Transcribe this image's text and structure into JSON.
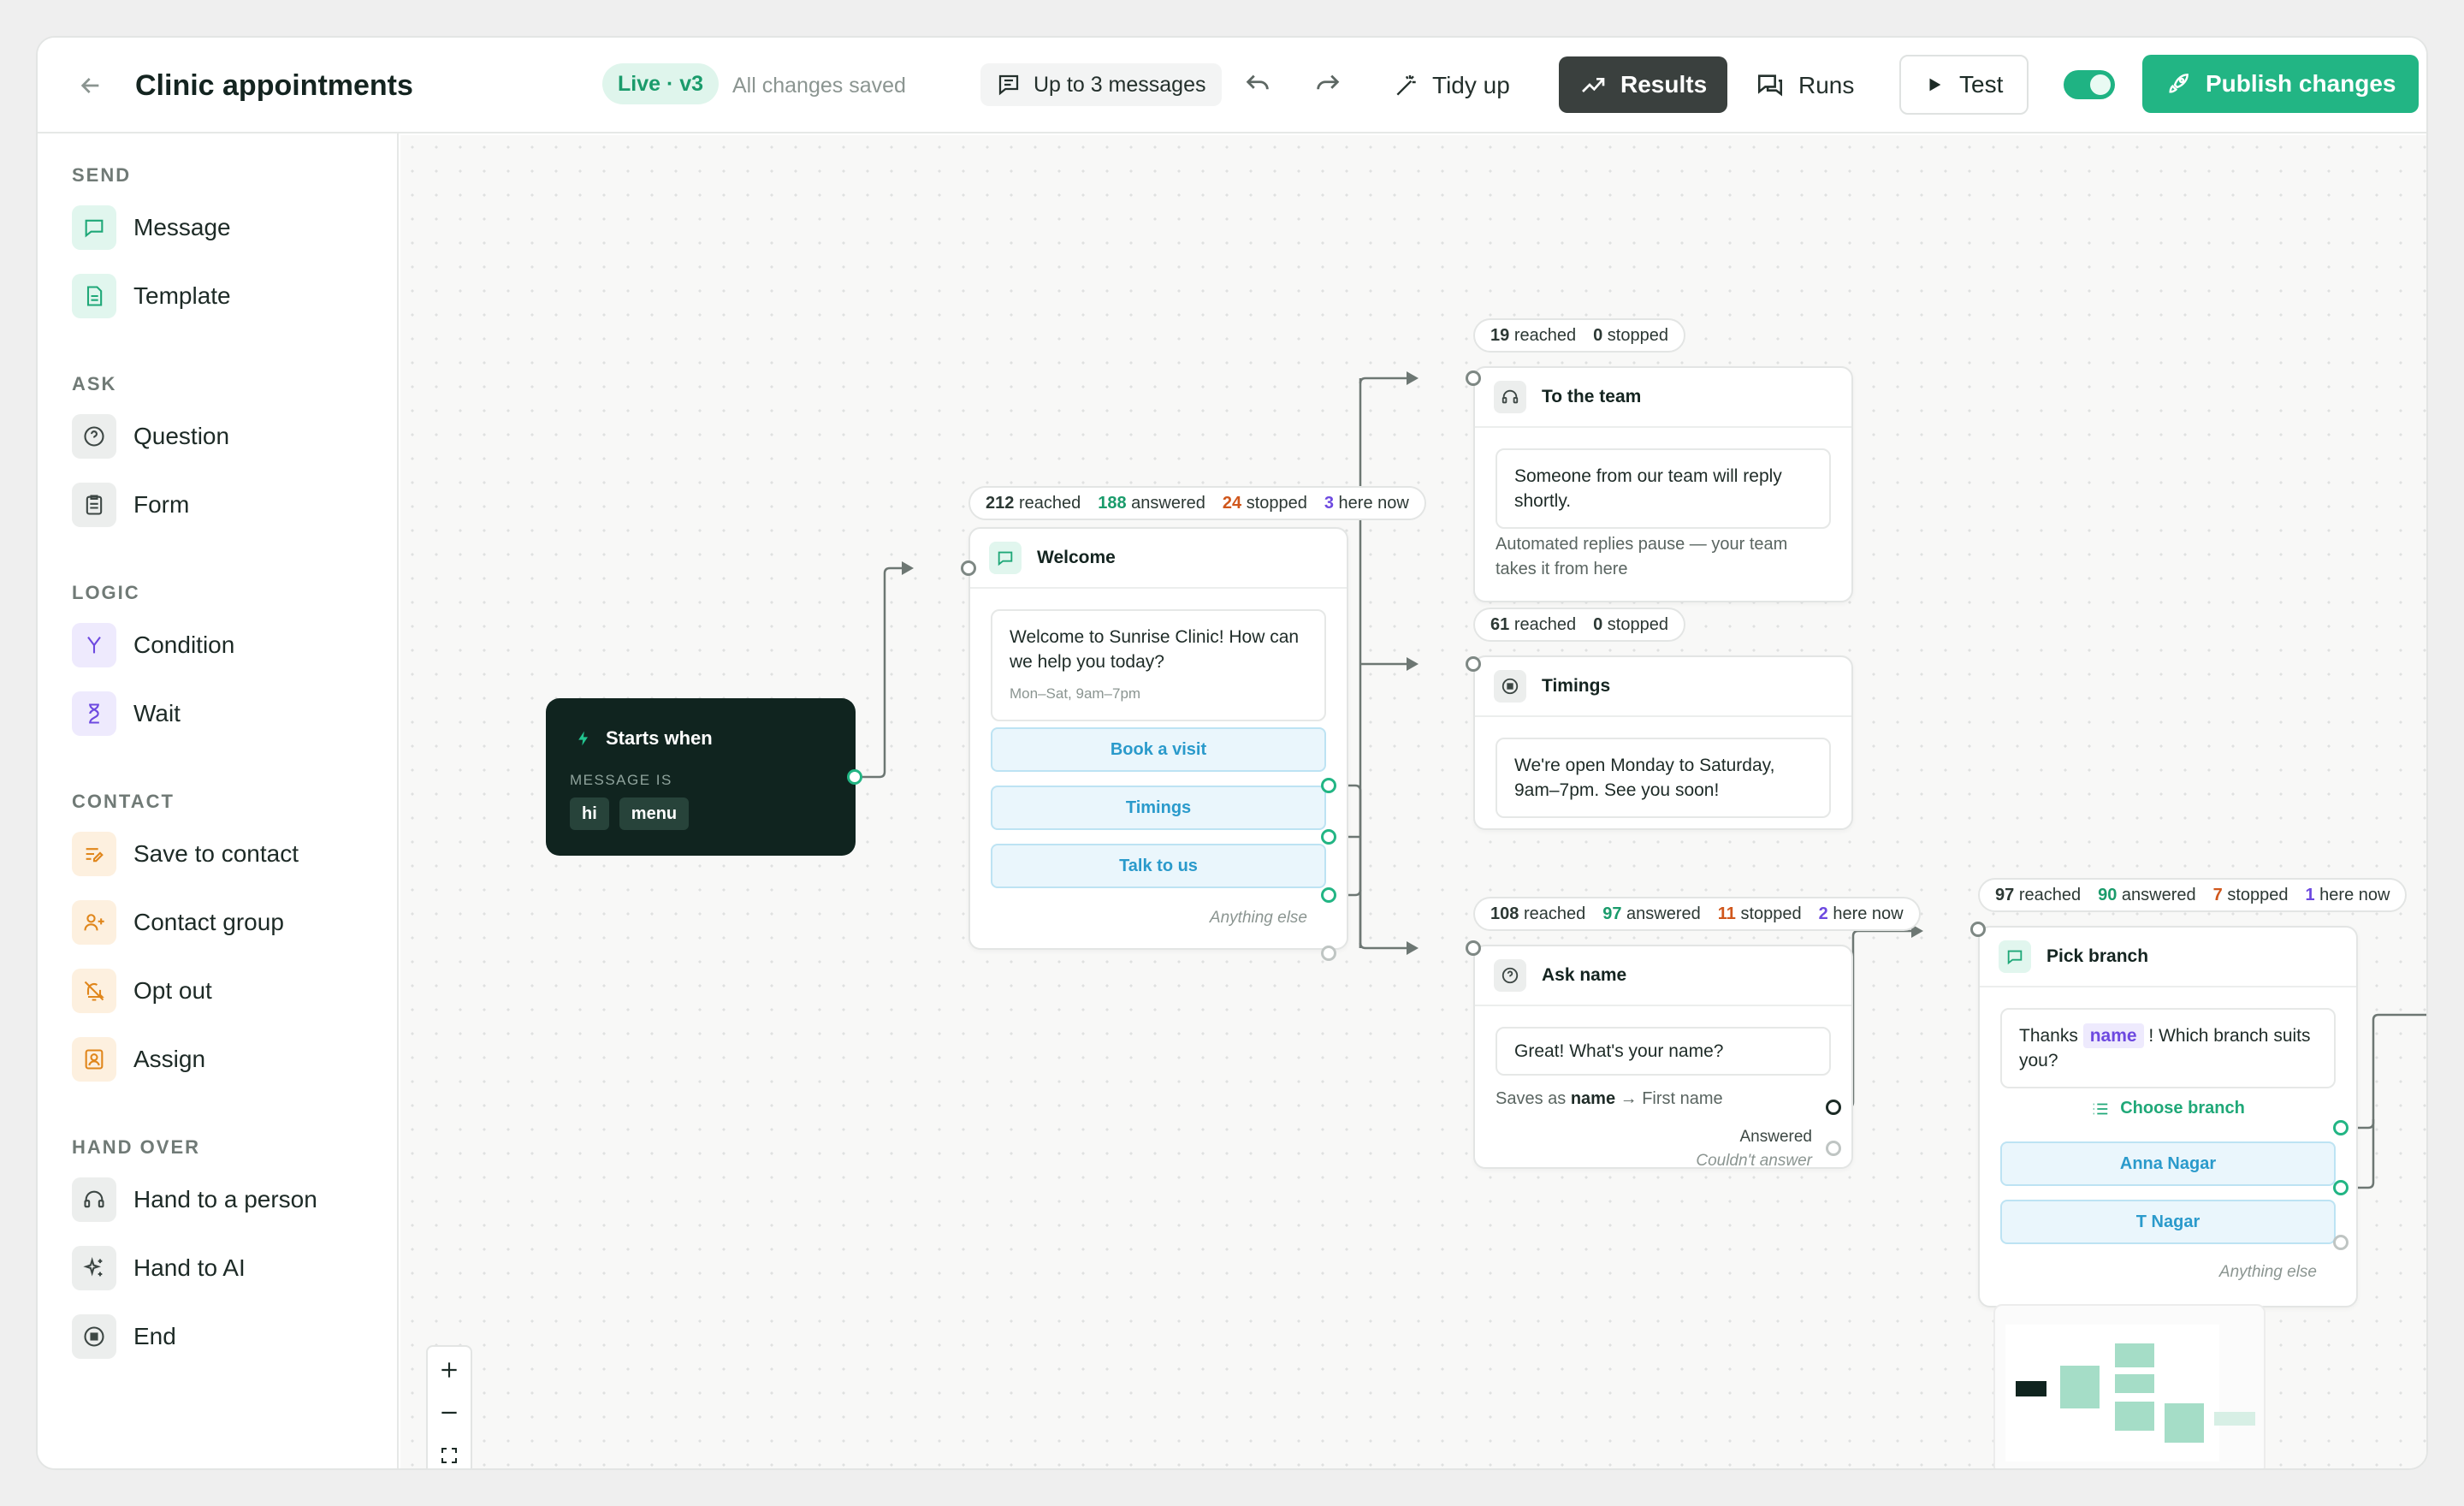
{
  "header": {
    "title": "Clinic appointments",
    "status": "Live · v3",
    "save_state": "All changes saved",
    "message_limit": "Up to 3 messages",
    "tidy_label": "Tidy up",
    "results_label": "Results",
    "runs_label": "Runs",
    "test_label": "Test",
    "publish_label": "Publish changes",
    "live_toggle": "on"
  },
  "sidebar": {
    "sections": [
      {
        "title": "SEND",
        "items": [
          {
            "label": "Message",
            "icon": "message-icon"
          },
          {
            "label": "Template",
            "icon": "template-icon"
          }
        ]
      },
      {
        "title": "ASK",
        "items": [
          {
            "label": "Question",
            "icon": "question-icon"
          },
          {
            "label": "Form",
            "icon": "form-icon"
          }
        ]
      },
      {
        "title": "LOGIC",
        "items": [
          {
            "label": "Condition",
            "icon": "condition-icon"
          },
          {
            "label": "Wait",
            "icon": "hourglass-icon"
          }
        ]
      },
      {
        "title": "CONTACT",
        "items": [
          {
            "label": "Save to contact",
            "icon": "save-contact-icon"
          },
          {
            "label": "Contact group",
            "icon": "contact-group-icon"
          },
          {
            "label": "Opt out",
            "icon": "bell-off-icon"
          },
          {
            "label": "Assign",
            "icon": "assign-icon"
          }
        ]
      },
      {
        "title": "HAND OVER",
        "items": [
          {
            "label": "Hand to a person",
            "icon": "headset-icon"
          },
          {
            "label": "Hand to AI",
            "icon": "sparkle-icon"
          },
          {
            "label": "End",
            "icon": "stop-icon"
          }
        ]
      }
    ]
  },
  "canvas": {
    "trigger": {
      "title": "Starts when",
      "label": "MESSAGE IS",
      "keywords": [
        "hi",
        "menu"
      ]
    },
    "welcome": {
      "stats": {
        "reached": "212",
        "answered": "188",
        "stopped": "24",
        "here": "3"
      },
      "title": "Welcome",
      "message": "Welcome to Sunrise Clinic! How can we help you today?",
      "subtext": "Mon–Sat, 9am–7pm",
      "choices": [
        "Book a visit",
        "Timings",
        "Talk to us"
      ],
      "fallback": "Anything else"
    },
    "team": {
      "stats": {
        "reached": "19",
        "stopped": "0"
      },
      "title": "To the team",
      "message": "Someone from our team will reply shortly.",
      "note": "Automated replies pause — your team takes it from here"
    },
    "timings": {
      "stats": {
        "reached": "61",
        "stopped": "0"
      },
      "title": "Timings",
      "message": "We're open Monday to Saturday, 9am–7pm. See you soon!"
    },
    "ask": {
      "stats": {
        "reached": "108",
        "answered": "97",
        "stopped": "11",
        "here": "2"
      },
      "title": "Ask name",
      "message": "Great! What's your name?",
      "saves_prefix": "Saves as",
      "saves_var": "name",
      "saves_target": "→ First name",
      "answered": "Answered",
      "failed": "Couldn't answer"
    },
    "branch": {
      "stats": {
        "reached": "97",
        "answered": "90",
        "stopped": "7",
        "here": "1"
      },
      "title": "Pick branch",
      "msg_prefix": "Thanks",
      "msg_var": "name",
      "msg_suffix": "! Which branch suits you?",
      "list_label": "Choose branch",
      "choices": [
        "Anna Nagar",
        "T Nagar"
      ],
      "fallback": "Anything else"
    },
    "stat_labels": {
      "reached": "reached",
      "answered": "answered",
      "stopped": "stopped",
      "here": "here now"
    }
  },
  "colors": {
    "accent": "#22b584",
    "dark": "#10241f",
    "choice": "#2a9acb",
    "stopped": "#d0571c",
    "here": "#6d49e0"
  }
}
